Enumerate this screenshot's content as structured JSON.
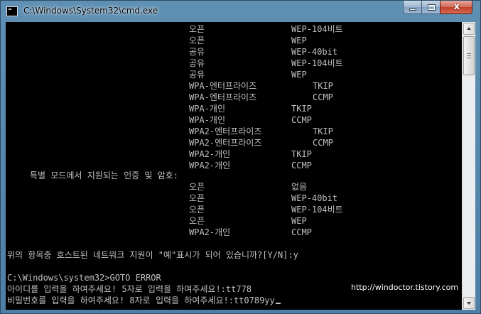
{
  "window": {
    "title": "C:\\Windows\\System32\\cmd.exe",
    "close_glyph": "x"
  },
  "colors": {
    "console_bg": "#000000",
    "console_text": "#c0c0c0",
    "title_gradient_top": "#5f90b4",
    "close_button": "#c0412c"
  },
  "console": {
    "auth_rows_top": [
      {
        "auth": "오픈",
        "cipher": "WEP-104비트"
      },
      {
        "auth": "오픈",
        "cipher": "WEP"
      },
      {
        "auth": "공유",
        "cipher": "WEP-40bit"
      },
      {
        "auth": "공유",
        "cipher": "WEP-104비트"
      },
      {
        "auth": "공유",
        "cipher": "WEP"
      },
      {
        "auth": "WPA-엔터프라이즈",
        "cipher": "TKIP"
      },
      {
        "auth": "WPA-엔터프라이즈",
        "cipher": "CCMP"
      },
      {
        "auth": "WPA-개인",
        "cipher": "TKIP"
      },
      {
        "auth": "WPA-개인",
        "cipher": "CCMP"
      },
      {
        "auth": "WPA2-엔터프라이즈",
        "cipher": "TKIP"
      },
      {
        "auth": "WPA2-엔터프라이즈",
        "cipher": "CCMP"
      },
      {
        "auth": "WPA2-개인",
        "cipher": "TKIP"
      },
      {
        "auth": "WPA2-개인",
        "cipher": "CCMP"
      }
    ],
    "adhoc_header": "특별 모드에서 지원되는 인증 및 암호:",
    "auth_rows_adhoc": [
      {
        "auth": "오픈",
        "cipher": "없음"
      },
      {
        "auth": "오픈",
        "cipher": "WEP-40bit"
      },
      {
        "auth": "오픈",
        "cipher": "WEP-104비트"
      },
      {
        "auth": "오픈",
        "cipher": "WEP"
      },
      {
        "auth": "WPA2-개인",
        "cipher": "CCMP"
      }
    ],
    "question": "위의 항목중 호스트된 네트워크 지원이 \"예\"표시가 되어 있습니까?[Y/N]:y",
    "prompt_line": "C:\\Windows\\system32>GOTO ERROR",
    "id_line": "아이디를 입력을 하여주세요! 5자로 입력을 하여주세요!:tt778",
    "pw_line": "비밀번호를 입력을 하여주세요! 8자로 입력을 하여주세요!:tt0789yy"
  },
  "watermark": "http://windoctor.tistory.com"
}
